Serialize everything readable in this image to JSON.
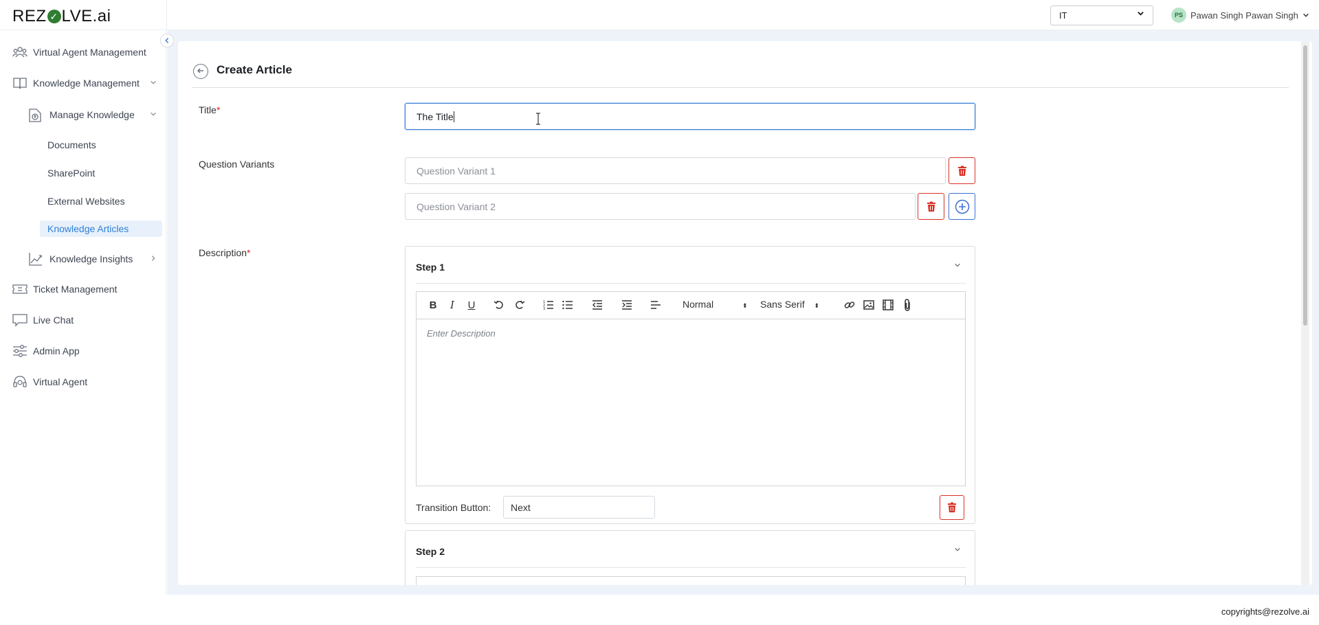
{
  "brand": {
    "logo_prefix": "REZ",
    "logo_check": "✓",
    "logo_suffix": "LVE",
    "logo_domain": ".ai"
  },
  "header": {
    "department_select": "IT",
    "user_initials": "PS",
    "user_name": "Pawan Singh Pawan Singh"
  },
  "sidebar": {
    "items": [
      {
        "label": "Virtual Agent Management",
        "icon": "users-icon"
      },
      {
        "label": "Knowledge Management",
        "icon": "book-icon"
      },
      {
        "label": "Manage Knowledge",
        "icon": "upload-icon"
      },
      {
        "label": "Documents"
      },
      {
        "label": "SharePoint"
      },
      {
        "label": "External Websites"
      },
      {
        "label": "Knowledge Articles",
        "active": true
      },
      {
        "label": "Knowledge Insights",
        "icon": "chart-icon"
      },
      {
        "label": "Ticket Management",
        "icon": "ticket-icon"
      },
      {
        "label": "Live Chat",
        "icon": "chat-icon"
      },
      {
        "label": "Admin App",
        "icon": "sliders-icon"
      },
      {
        "label": "Virtual Agent",
        "icon": "headset-icon"
      }
    ]
  },
  "page": {
    "title": "Create Article",
    "title_label": "Title",
    "title_value": "The Title",
    "required_mark": "*",
    "question_variants_label": "Question Variants",
    "question_variants": [
      {
        "placeholder": "Question Variant 1"
      },
      {
        "placeholder": "Question Variant 2"
      }
    ],
    "description_label": "Description",
    "steps": [
      {
        "title": "Step 1",
        "editor_placeholder": "Enter Description",
        "transition_label": "Transition Button:",
        "transition_value": "Next"
      },
      {
        "title": "Step 2"
      }
    ],
    "toolbar": {
      "heading_select": "Normal",
      "font_select": "Sans Serif"
    }
  },
  "footer": {
    "copyright": "copyrights@rezolve.ai"
  },
  "colors": {
    "accent": "#2f7fd8",
    "danger": "#d93025",
    "page_bg": "#eef3fa"
  }
}
